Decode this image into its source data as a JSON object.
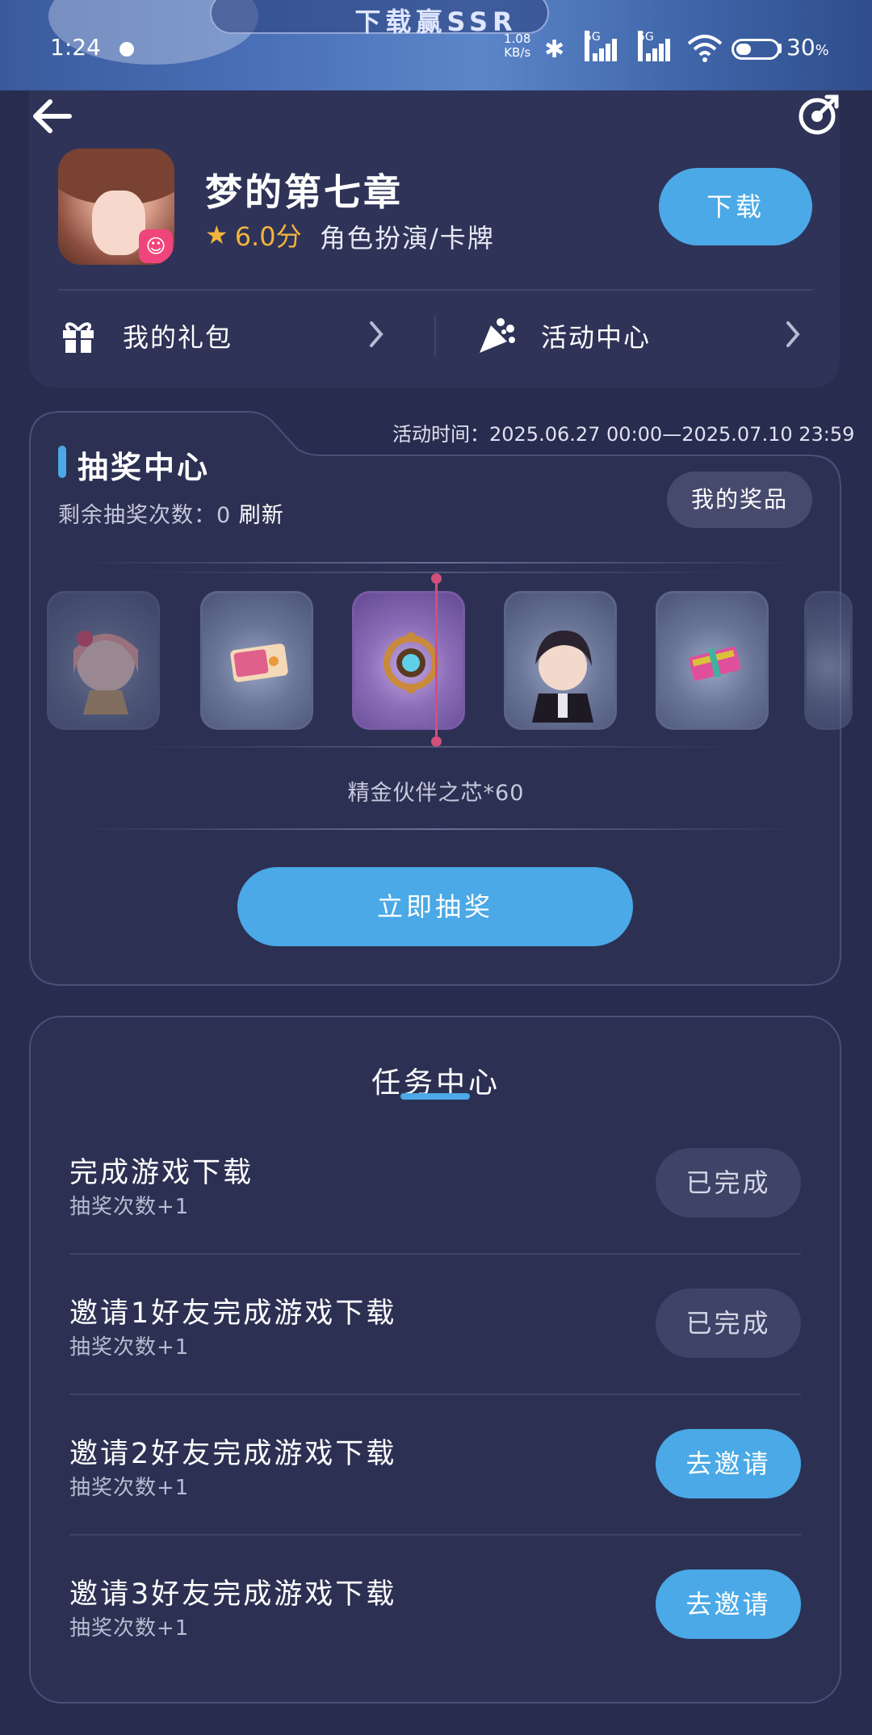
{
  "status_bar": {
    "time": "1:24",
    "net_speed_value": "1.08",
    "net_speed_unit": "KB/s",
    "signal1": "5G",
    "signal2": "5G",
    "battery": "30",
    "battery_unit": "%"
  },
  "banner": {
    "text": "下载赢SSR"
  },
  "game": {
    "title": "梦的第七章",
    "rating": "6.0分",
    "category": "角色扮演/卡牌",
    "download_label": "下载"
  },
  "links": {
    "gift": "我的礼包",
    "activity": "活动中心"
  },
  "lottery": {
    "title": "抽奖中心",
    "activity_time": "活动时间：2025.06.27 00:00—2025.07.10 23:59",
    "remaining_label": "剩余抽奖次数：0",
    "refresh_label": "刷新",
    "my_prizes_label": "我的奖品",
    "selected_prize_name": "精金伙伴之芯*60",
    "draw_label": "立即抽奖",
    "prizes": [
      "character-girl",
      "ticket",
      "core-gem",
      "character-boy",
      "gift-box"
    ]
  },
  "tasks": {
    "title": "任务中心",
    "items": [
      {
        "name": "完成游戏下载",
        "reward": "抽奖次数+1",
        "button": "已完成",
        "status": "done"
      },
      {
        "name": "邀请1好友完成游戏下载",
        "reward": "抽奖次数+1",
        "button": "已完成",
        "status": "done"
      },
      {
        "name": "邀请2好友完成游戏下载",
        "reward": "抽奖次数+1",
        "button": "去邀请",
        "status": "todo"
      },
      {
        "name": "邀请3好友完成游戏下载",
        "reward": "抽奖次数+1",
        "button": "去邀请",
        "status": "todo"
      }
    ]
  },
  "colors": {
    "background": "#282c4e",
    "accent": "#4aa9e6",
    "rating": "#f3b33d",
    "indicator": "#d0507a"
  }
}
